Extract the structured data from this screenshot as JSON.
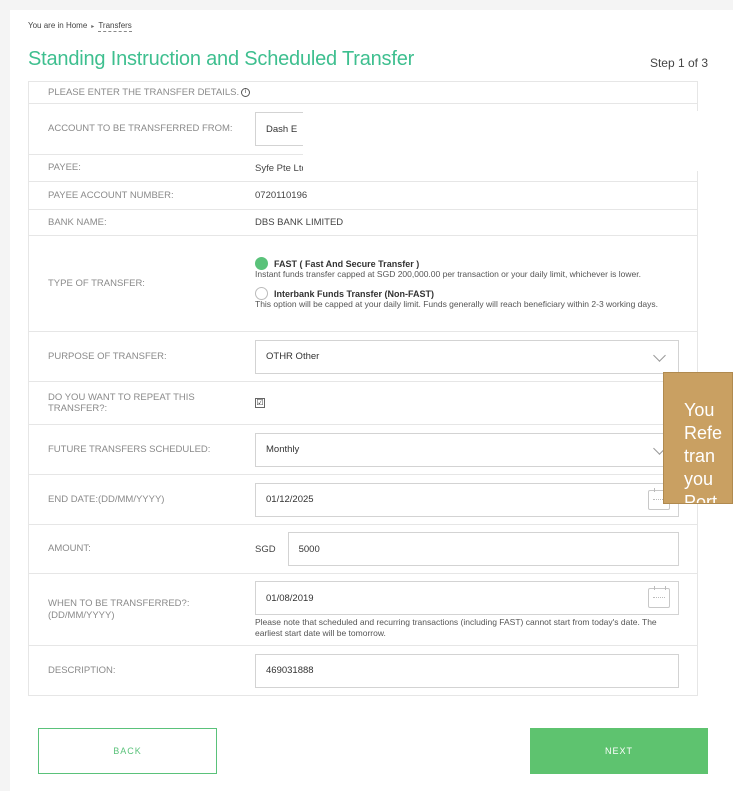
{
  "breadcrumb": {
    "prefix": "You are in Home",
    "current": "Transfers"
  },
  "title": "Standing Instruction and Scheduled Transfer",
  "step": "Step 1 of 3",
  "form": {
    "header": "PLEASE ENTER THE TRANSFER DETAILS.",
    "account_from": {
      "label": "ACCOUNT TO BE TRANSFERRED FROM:",
      "value": "Dash E"
    },
    "payee": {
      "label": "PAYEE:",
      "value": "Syfe Pte Ltd Clients"
    },
    "payee_account": {
      "label": "PAYEE ACCOUNT NUMBER:",
      "value": "0720110196"
    },
    "bank_name": {
      "label": "BANK NAME:",
      "value": "DBS BANK LIMITED"
    },
    "transfer_type": {
      "label": "TYPE OF TRANSFER:",
      "options": [
        {
          "title": "FAST ( Fast And Secure Transfer )",
          "desc": "Instant funds transfer capped at SGD 200,000.00 per transaction or your daily limit, whichever is lower.",
          "selected": true
        },
        {
          "title": "Interbank Funds Transfer (Non-FAST)",
          "desc": "This option will be capped at your daily limit. Funds generally will reach beneficiary within 2-3 working days.",
          "selected": false
        }
      ]
    },
    "purpose": {
      "label": "PURPOSE OF TRANSFER:",
      "value": "OTHR Other"
    },
    "repeat": {
      "label": "DO YOU WANT TO REPEAT THIS TRANSFER?:",
      "checked": true,
      "mark": "☑"
    },
    "future": {
      "label": "FUTURE TRANSFERS SCHEDULED:",
      "value": "Monthly"
    },
    "end_date": {
      "label": "END DATE:(DD/MM/YYYY)",
      "value": "01/12/2025"
    },
    "amount": {
      "label": "AMOUNT:",
      "currency": "SGD",
      "value": "5000"
    },
    "when": {
      "label": "WHEN TO BE TRANSFERRED?:(DD/MM/YYYY)",
      "value": "01/08/2019",
      "note": "Please note that scheduled and recurring transactions (including FAST) cannot start from today's date. The earliest start date will be tomorrow."
    },
    "description": {
      "label": "DESCRIPTION:",
      "value": "469031888"
    }
  },
  "tooltip": {
    "lines": [
      "You",
      "Refe",
      "tran",
      "you",
      "Port"
    ]
  },
  "buttons": {
    "back": "BACK",
    "next": "NEXT"
  },
  "colors": {
    "accent": "#3ebf8f",
    "button_green": "#5ec36f",
    "tooltip_bg": "#c9a062"
  }
}
